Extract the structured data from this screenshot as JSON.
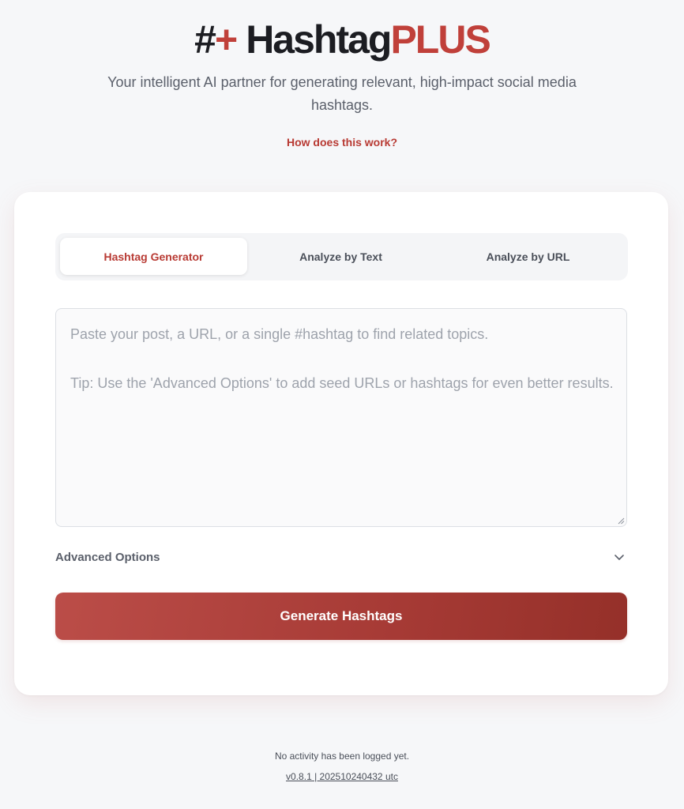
{
  "header": {
    "logo": {
      "hash": "#",
      "plus": "+",
      "word_dark": "Hashtag",
      "word_red": "PLUS"
    },
    "tagline": "Your intelligent AI partner for generating relevant, high-impact social media hashtags.",
    "how_link": "How does this work?"
  },
  "tabs": [
    {
      "label": "Hashtag Generator",
      "active": true
    },
    {
      "label": "Analyze by Text",
      "active": false
    },
    {
      "label": "Analyze by URL",
      "active": false
    }
  ],
  "input": {
    "value": "",
    "placeholder": "Paste your post, a URL, or a single #hashtag to find related topics.\n\nTip: Use the 'Advanced Options' to add seed URLs or hashtags for even better results."
  },
  "advanced": {
    "label": "Advanced Options",
    "icon": "chevron-down-icon",
    "expanded": false
  },
  "generate_button": {
    "label": "Generate Hashtags"
  },
  "footer": {
    "activity": "No activity has been logged yet.",
    "version": "v0.8.1 | 202510240432 utc"
  },
  "colors": {
    "brand_red": "#c0403a",
    "brand_dark": "#1c1d22",
    "page_bg": "#f6f7f9",
    "button_gradient_start": "#bb4d48",
    "button_gradient_end": "#953029"
  }
}
